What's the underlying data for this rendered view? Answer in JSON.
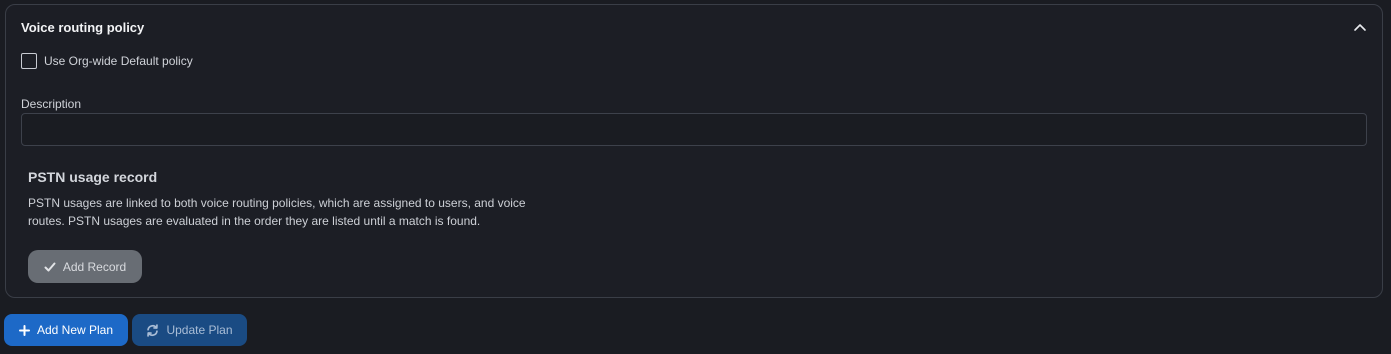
{
  "panel": {
    "title": "Voice routing policy",
    "collapse_icon": "chevron-up-icon"
  },
  "org_default": {
    "label": "Use Org-wide Default policy",
    "checked": false
  },
  "description": {
    "label": "Description",
    "value": "",
    "placeholder": ""
  },
  "pstn": {
    "title": "PSTN usage record",
    "text": "PSTN usages are linked to both voice routing policies, which are assigned to users, and voice routes. PSTN usages are evaluated in the order they are listed until a match is found.",
    "add_record": {
      "label": "Add Record",
      "icon": "check-icon"
    }
  },
  "footer": {
    "add_plan": {
      "label": "Add New Plan",
      "icon": "plus-icon"
    },
    "update_plan": {
      "label": "Update Plan",
      "icon": "refresh-icon"
    }
  },
  "colors": {
    "background": "#1a1c22",
    "primary": "#1d69c7",
    "secondary": "#1a4b83",
    "muted_button": "#686d74"
  }
}
